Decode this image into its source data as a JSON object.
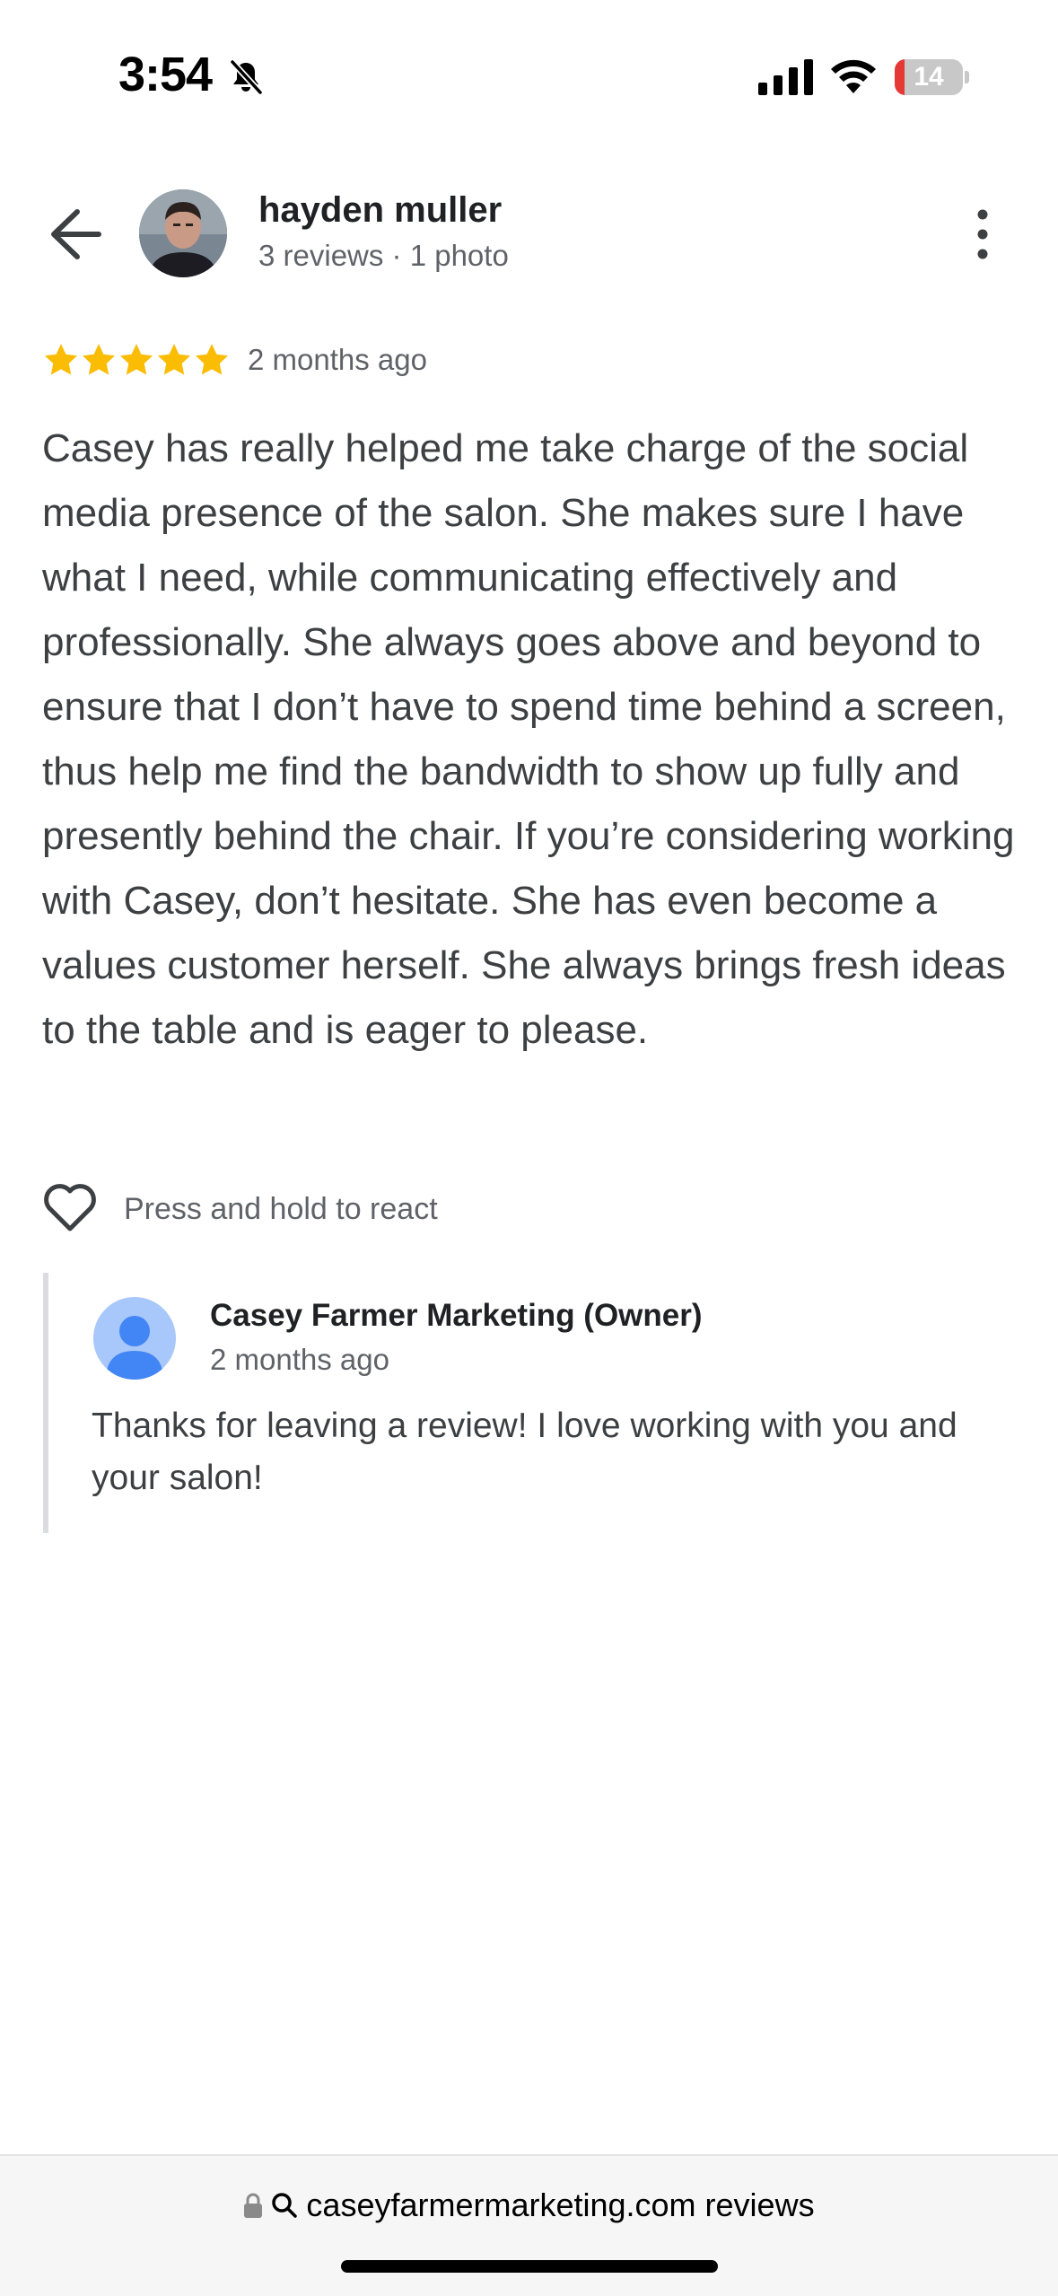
{
  "status_bar": {
    "time": "3:54",
    "battery": "14",
    "battery_level": 0.14
  },
  "reviewer": {
    "name": "hayden muller",
    "meta": "3 reviews · 1 photo"
  },
  "review": {
    "rating": 5,
    "date": "2 months ago",
    "text": "Casey has really helped me take charge of the social media presence of the salon. She makes sure I have what I need, while communicating effectively and professionally. She always goes above and beyond to ensure that I don’t have to spend time behind a screen, thus help me find the bandwidth to show up fully and presently behind the chair. If you’re considering working with Casey, don’t hesitate. She has even become a values customer herself. She always brings fresh ideas to the table and is eager to please."
  },
  "react": {
    "label": "Press and hold to react"
  },
  "owner_reply": {
    "name": "Casey Farmer Marketing (Owner)",
    "date": "2 months ago",
    "text": "Thanks for leaving a review! I love working with you and your salon!"
  },
  "browser": {
    "url": "caseyfarmermarketing.com reviews"
  },
  "colors": {
    "star": "#fbbc04",
    "battery_low": "#e53935",
    "owner_avatar_bg": "#a8c7fa",
    "owner_avatar_fg": "#4285f4"
  }
}
